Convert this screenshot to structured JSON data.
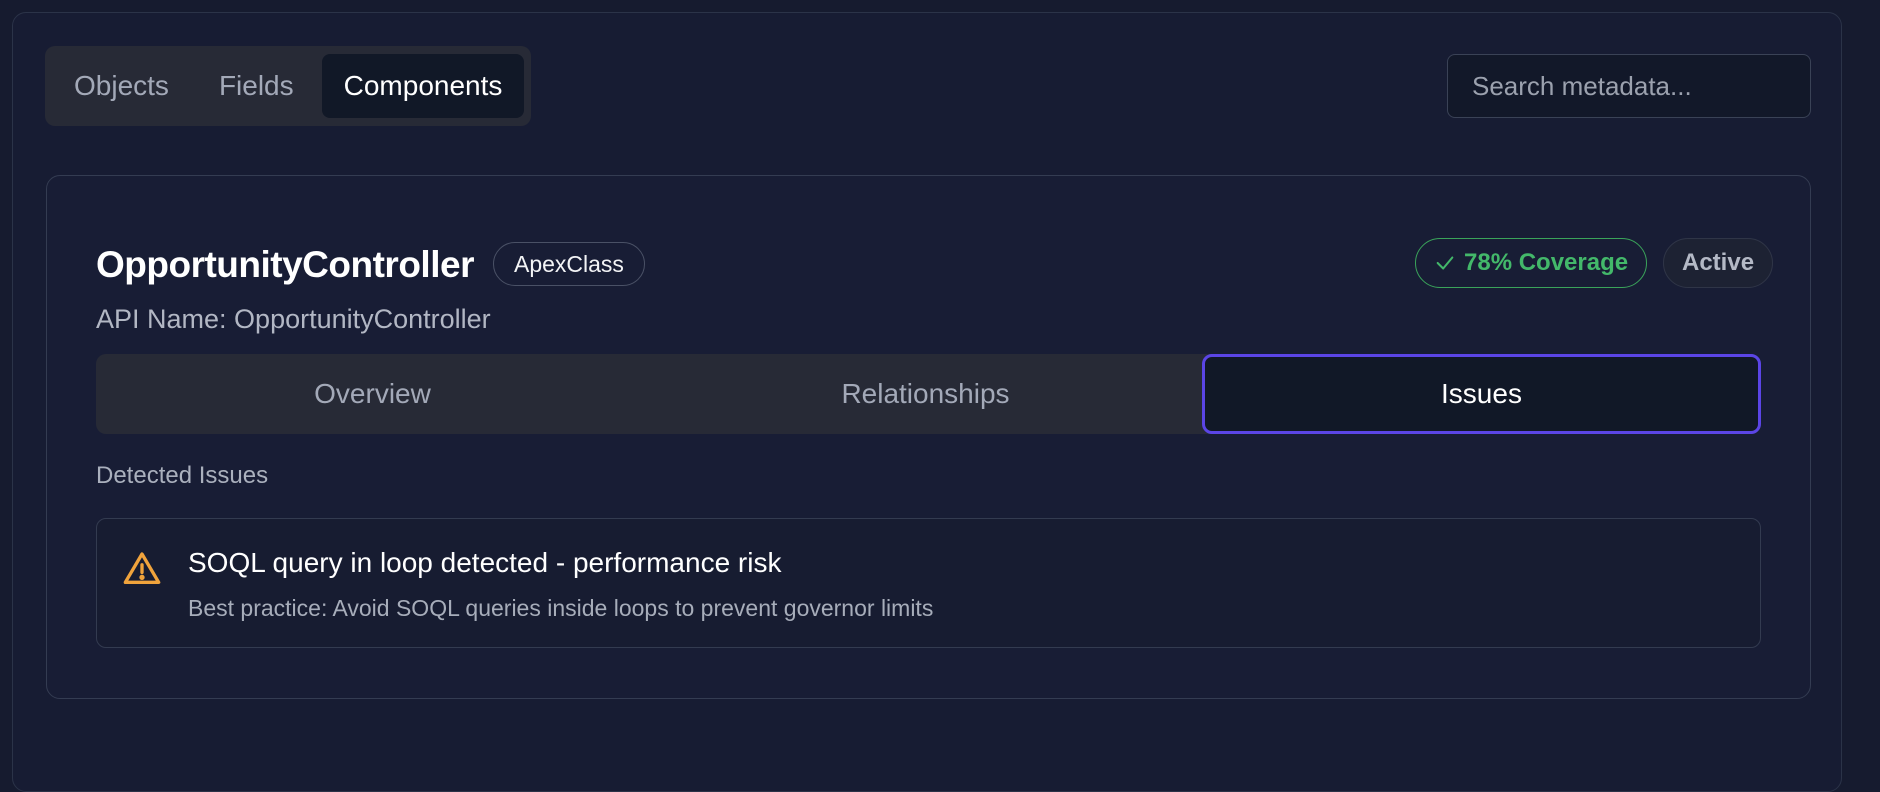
{
  "top_tabs": [
    {
      "label": "Objects",
      "active": false
    },
    {
      "label": "Fields",
      "active": false
    },
    {
      "label": "Components",
      "active": true
    }
  ],
  "search": {
    "placeholder": "Search metadata..."
  },
  "component": {
    "name": "OpportunityController",
    "type": "ApexClass",
    "api_name": "API Name: OpportunityController",
    "coverage": "78% Coverage",
    "status": "Active"
  },
  "detail_tabs": [
    {
      "label": "Overview",
      "active": false
    },
    {
      "label": "Relationships",
      "active": false
    },
    {
      "label": "Issues",
      "active": true
    }
  ],
  "issues_section": {
    "label": "Detected Issues",
    "items": [
      {
        "icon": "warning-icon",
        "title": "SOQL query in loop detected - performance risk",
        "description": "Best practice: Avoid SOQL queries inside loops to prevent governor limits"
      }
    ]
  },
  "colors": {
    "accent": "#5b45e6",
    "success": "#43b86a",
    "warning": "#f0a33c",
    "background": "#171c33"
  }
}
